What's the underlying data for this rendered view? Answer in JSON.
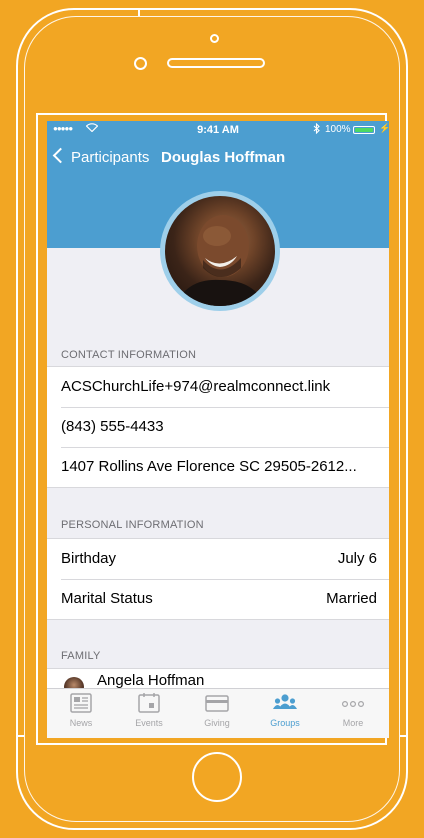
{
  "status_bar": {
    "time": "9:41 AM",
    "battery": "100%"
  },
  "nav": {
    "back_label": "Participants",
    "title": "Douglas Hoffman"
  },
  "contact": {
    "title": "CONTACT INFORMATION",
    "email": "ACSChurchLife+974@realmconnect.link",
    "phone": "(843) 555-4433",
    "address": "1407 Rollins Ave Florence SC 29505-2612..."
  },
  "personal": {
    "title": "PERSONAL INFORMATION",
    "rows": [
      {
        "label": "Birthday",
        "value": "July 6"
      },
      {
        "label": "Marital Status",
        "value": "Married"
      }
    ]
  },
  "family": {
    "title": "FAMILY",
    "members": [
      {
        "name": "Angela Hoffman"
      }
    ]
  },
  "tabs": [
    {
      "label": "News",
      "icon": "news-icon"
    },
    {
      "label": "Events",
      "icon": "calendar-icon"
    },
    {
      "label": "Giving",
      "icon": "credit-card-icon"
    },
    {
      "label": "Groups",
      "icon": "groups-icon",
      "active": true
    },
    {
      "label": "More",
      "icon": "more-icon"
    }
  ],
  "colors": {
    "background": "#F2A623",
    "accent": "#4C9ED0",
    "battery": "#4CD964"
  }
}
